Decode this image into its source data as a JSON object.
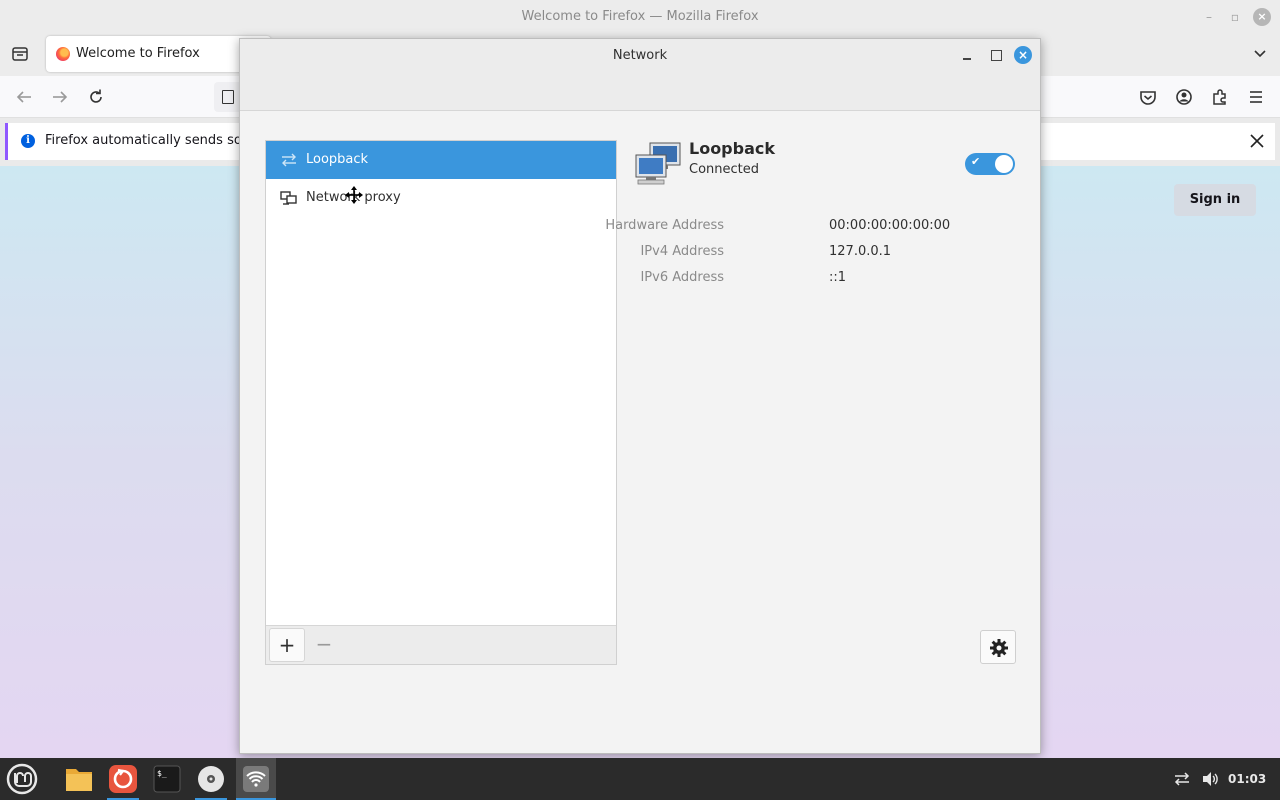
{
  "firefox": {
    "window_title": "Welcome to Firefox — Mozilla Firefox",
    "tab_title": "Welcome to Firefox",
    "notice_text": "Firefox automatically sends some",
    "notice_info_glyph": "i",
    "sign_in_label": "Sign in"
  },
  "network_dialog": {
    "title": "Network",
    "close_glyph": "×",
    "connections": [
      {
        "label": "Loopback",
        "icon": "loopback-arrows-icon",
        "selected": true
      },
      {
        "label": "Network proxy",
        "icon": "network-proxy-icon",
        "selected": false
      }
    ],
    "add_label": "+",
    "remove_label": "−",
    "device": {
      "name": "Loopback",
      "status": "Connected",
      "enabled": true,
      "toggle_check": "✔"
    },
    "details": [
      {
        "key": "Hardware Address",
        "value": "00:00:00:00:00:00"
      },
      {
        "key": "IPv4 Address",
        "value": "127.0.0.1"
      },
      {
        "key": "IPv6 Address",
        "value": "::1"
      }
    ]
  },
  "taskbar": {
    "clock": "01:03",
    "apps": [
      "menu-icon",
      "files-icon",
      "software-manager-icon",
      "terminal-icon",
      "disks-icon",
      "network-icon"
    ]
  },
  "colors": {
    "accent": "#3a96dd",
    "taskbar": "#2b2b2b",
    "firefox_notice_border": "#9059ff"
  }
}
